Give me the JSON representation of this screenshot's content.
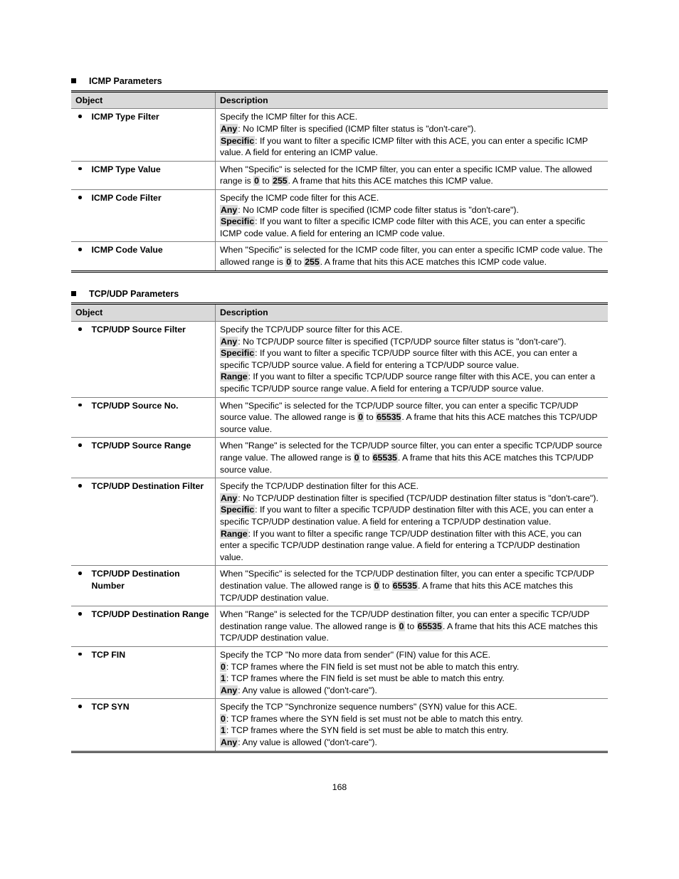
{
  "pageNumber": "168",
  "section1": {
    "title": "ICMP Parameters",
    "head_obj": "Object",
    "head_desc": "Description",
    "rows": [
      {
        "obj": "ICMP Type Filter",
        "desc": "Specify the ICMP filter for this ACE.\n<span class='hl'>Any</span>: No ICMP filter is specified (ICMP filter status is \"don't-care\").\n<span class='hl'>Specific</span>: If you want to filter a specific ICMP filter with this ACE, you can enter a specific ICMP value. A field for entering an ICMP value."
      },
      {
        "obj": "ICMP Type Value",
        "desc": "When \"Specific\" is selected for the ICMP filter, you can enter a specific ICMP value. The allowed range is <span class='hl'>0</span> to <span class='hl'>255</span>. A frame that hits this ACE matches this ICMP value."
      },
      {
        "obj": "ICMP Code Filter",
        "desc": "Specify the ICMP code filter for this ACE.\n<span class='hl'>Any</span>: No ICMP code filter is specified (ICMP code filter status is \"don't-care\").\n<span class='hl'>Specific</span>: If you want to filter a specific ICMP code filter with this ACE, you can enter a specific ICMP code value. A field for entering an ICMP code value."
      },
      {
        "obj": "ICMP Code Value",
        "desc": "When \"Specific\" is selected for the ICMP code filter, you can enter a specific ICMP code value. The allowed range is <span class='hl'>0</span> to <span class='hl'>255</span>. A frame that hits this ACE matches this ICMP code value."
      }
    ]
  },
  "section2": {
    "title": "TCP/UDP Parameters",
    "head_obj": "Object",
    "head_desc": "Description",
    "rows": [
      {
        "obj": "TCP/UDP Source Filter",
        "desc": "Specify the TCP/UDP source filter for this ACE.\n<span class='hl'>Any</span>: No TCP/UDP source filter is specified (TCP/UDP source filter status is \"don't-care\").\n<span class='hl'>Specific</span>: If you want to filter a specific TCP/UDP source filter with this ACE, you can enter a specific TCP/UDP source value. A field for entering a TCP/UDP source value.\n<span class='hl'>Range</span>: If you want to filter a specific TCP/UDP source range filter with this ACE, you can enter a specific TCP/UDP source range value. A field for entering a TCP/UDP source value."
      },
      {
        "obj": "TCP/UDP Source No.",
        "desc": "When \"Specific\" is selected for the TCP/UDP source filter, you can enter a specific TCP/UDP source value. The allowed range is <span class='hl'>0</span> to <span class='hl'>65535</span>. A frame that hits this ACE matches this TCP/UDP source value."
      },
      {
        "obj": "TCP/UDP Source Range",
        "desc": "When \"Range\" is selected for the TCP/UDP source filter, you can enter a specific TCP/UDP source range value. The allowed range is <span class='hl'>0</span> to <span class='hl'>65535</span>. A frame that hits this ACE matches this TCP/UDP source value."
      },
      {
        "obj": "TCP/UDP Destination Filter",
        "desc": "Specify the TCP/UDP destination filter for this ACE.\n<span class='hl'>Any</span>: No TCP/UDP destination filter is specified (TCP/UDP destination filter status is \"don't-care\").\n<span class='hl'>Specific</span>: If you want to filter a specific TCP/UDP destination filter with this ACE, you can enter a specific TCP/UDP destination value. A field for entering a TCP/UDP destination value.\n<span class='hl'>Range</span>: If you want to filter a specific range TCP/UDP destination filter with this ACE, you can enter a specific TCP/UDP destination range value. A field for entering a TCP/UDP destination value."
      },
      {
        "obj": "TCP/UDP Destination Number",
        "desc": "When \"Specific\" is selected for the TCP/UDP destination filter, you can enter a specific TCP/UDP destination value. The allowed range is <span class='hl'>0</span> to <span class='hl'>65535</span>. A frame that hits this ACE matches this TCP/UDP destination value."
      },
      {
        "obj": "TCP/UDP Destination Range",
        "desc": "When \"Range\" is selected for the TCP/UDP destination filter, you can enter a specific TCP/UDP destination range value. The allowed range is <span class='hl'>0</span> to <span class='hl'>65535</span>. A frame that hits this ACE matches this TCP/UDP destination value."
      },
      {
        "obj": "TCP FIN",
        "desc": "Specify the TCP \"No more data from sender\" (FIN) value for this ACE.\n<span class='hl'>0</span>: TCP frames where the FIN field is set must not be able to match this entry.\n<span class='hl'>1</span>: TCP frames where the FIN field is set must be able to match this entry.\n<span class='hl'>Any</span>: Any value is allowed (\"don't-care\")."
      },
      {
        "obj": "TCP SYN",
        "desc": "Specify the TCP \"Synchronize sequence numbers\" (SYN) value for this ACE.\n<span class='hl'>0</span>: TCP frames where the SYN field is set must not be able to match this entry.\n<span class='hl'>1</span>: TCP frames where the SYN field is set must be able to match this entry.\n<span class='hl'>Any</span>: Any value is allowed (\"don't-care\")."
      }
    ]
  }
}
